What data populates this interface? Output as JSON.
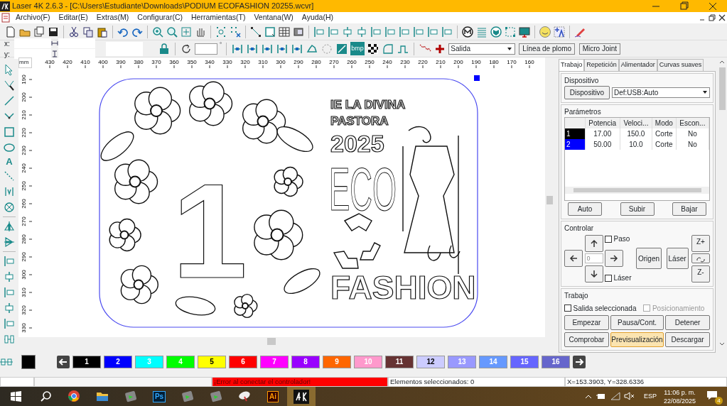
{
  "window": {
    "title": "Laser 4K 2.6.3 - [C:\\Users\\Estudiante\\Downloads\\PODIUM ECOFASHION 20255.wcvr]"
  },
  "menu": [
    "Archivo(F)",
    "Editar(E)",
    "Extras(M)",
    "Configurar(C)",
    "Herramientas(T)",
    "Ventana(W)",
    "Ayuda(H)"
  ],
  "toolbar2": {
    "x_label": "x:",
    "y_label": "y:",
    "degree_mark": "°",
    "bmp_label": "bmp",
    "output_select": "Salida",
    "buttons": [
      "Línea de plomo",
      "Micro Joint"
    ]
  },
  "left_tools": {
    "text_tool_label": "A"
  },
  "ruler": {
    "unit": "mm",
    "horizontal": [
      "430",
      "420",
      "410",
      "400",
      "390",
      "380",
      "370",
      "360",
      "350",
      "340",
      "330",
      "320",
      "310",
      "300",
      "290",
      "280",
      "270",
      "260",
      "250",
      "240",
      "230",
      "220",
      "210",
      "200",
      "190",
      "180",
      "170",
      "160"
    ],
    "vertical": [
      "190",
      "200",
      "210",
      "220",
      "230",
      "240",
      "250",
      "260",
      "270",
      "280",
      "290",
      "300",
      "310",
      "320",
      "330"
    ]
  },
  "design": {
    "texts": [
      {
        "kind": "line",
        "text": "IE LA DIVINA"
      },
      {
        "kind": "line",
        "text": "PASTORA"
      },
      {
        "kind": "year",
        "text": "2025"
      },
      {
        "kind": "big",
        "text": "ECO"
      },
      {
        "kind": "bottom",
        "text": "FASHION"
      },
      {
        "kind": "numeral",
        "text": "1"
      }
    ]
  },
  "panel": {
    "tabs": [
      {
        "label": "Trabajo",
        "selected": true
      },
      {
        "label": "Repetición",
        "selected": false
      },
      {
        "label": "Alimentador",
        "selected": false
      },
      {
        "label": "Curvas suaves",
        "selected": false
      }
    ],
    "device": {
      "title": "Dispositivo",
      "button": "Dispositivo",
      "select": "Def:USB:Auto"
    },
    "params": {
      "title": "Parámetros",
      "columns": [
        "Potencia",
        "Veloci...",
        "Modo",
        "Escon..."
      ],
      "rows": [
        {
          "layer": "1",
          "color": "#000000",
          "potencia": "17.00",
          "velocidad": "150.0",
          "modo": "Corte",
          "escon": "No"
        },
        {
          "layer": "2",
          "color": "#0000ff",
          "potencia": "50.00",
          "velocidad": "10.0",
          "modo": "Corte",
          "escon": "No"
        }
      ],
      "buttons": [
        "Auto",
        "Subir",
        "Bajar"
      ]
    },
    "control": {
      "title": "Controlar",
      "step": {
        "label": "Paso",
        "checked": false
      },
      "laser": {
        "label": "Láser",
        "checked": false
      },
      "step_value": "0",
      "buttons": [
        "Origen",
        "Láser"
      ],
      "z_up": "Z+",
      "z_down": "Z-"
    },
    "job": {
      "title": "Trabajo",
      "options": [
        {
          "label": "Salida seleccionada",
          "checked": false,
          "disabled": false
        },
        {
          "label": "Posicionamiento",
          "checked": false,
          "disabled": true
        }
      ],
      "buttons": [
        {
          "label": "Empezar",
          "selected": false
        },
        {
          "label": "Pausa/Cont.",
          "selected": false
        },
        {
          "label": "Detener",
          "selected": false
        },
        {
          "label": "Comprobar",
          "selected": false
        },
        {
          "label": "Previsualización",
          "selected": true
        },
        {
          "label": "Descargar",
          "selected": false
        }
      ]
    }
  },
  "palette": {
    "current_swatch": {
      "color": "#000000"
    },
    "colors": [
      {
        "label": "1",
        "color": "#000000"
      },
      {
        "label": "2",
        "color": "#0000ff"
      },
      {
        "label": "3",
        "color": "#00ffff"
      },
      {
        "label": "4",
        "color": "#00ff00"
      },
      {
        "label": "5",
        "color": "#ffff00"
      },
      {
        "label": "6",
        "color": "#ff0000"
      },
      {
        "label": "7",
        "color": "#ff00ff"
      },
      {
        "label": "8",
        "color": "#9900ff"
      },
      {
        "label": "9",
        "color": "#ff6600"
      },
      {
        "label": "10",
        "color": "#ff99cc"
      },
      {
        "label": "11",
        "color": "#663333"
      },
      {
        "label": "12",
        "color": "#ccccff"
      },
      {
        "label": "13",
        "color": "#9999ff"
      },
      {
        "label": "14",
        "color": "#6699ff"
      },
      {
        "label": "15",
        "color": "#6666ff"
      },
      {
        "label": "16",
        "color": "#6666cc"
      }
    ]
  },
  "status_bar": {
    "error": "¡Error al conectar el controlador!",
    "selection": "Elementos seleccionados: 0",
    "coordinates": "X=153.3903, Y=328.6336"
  },
  "taskbar": {
    "apps": [
      {
        "kind": "browser"
      },
      {
        "kind": "folder"
      },
      {
        "kind": "generic"
      },
      {
        "kind": "labeled",
        "label": "Ps"
      },
      {
        "kind": "generic"
      },
      {
        "kind": "generic"
      },
      {
        "kind": "dish"
      },
      {
        "kind": "labeled",
        "label": "Ai"
      },
      {
        "kind": "active"
      }
    ],
    "language": "ESP",
    "time": "11:06 p. m.",
    "date": "22/08/2025",
    "notifications": "4"
  }
}
